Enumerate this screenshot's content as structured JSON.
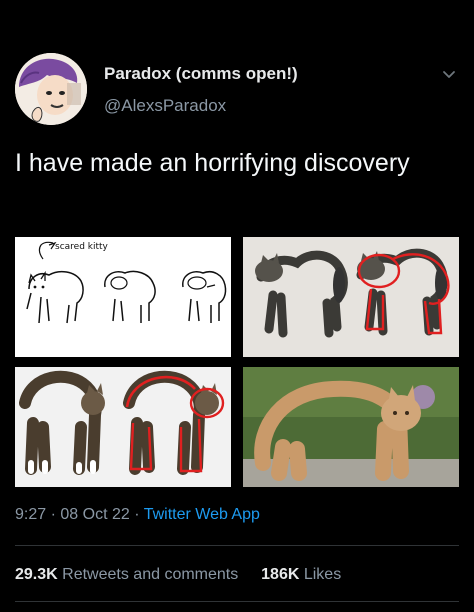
{
  "tweet": {
    "author": {
      "display_name": "Paradox (comms open!)",
      "handle": "@AlexsParadox"
    },
    "text": "I have made an horrifying discovery",
    "media": [
      {
        "caption": "scared kitty"
      },
      {},
      {},
      {}
    ],
    "meta": {
      "time": "9:27",
      "separator": "·",
      "date": "08 Oct 22",
      "app": "Twitter Web App"
    },
    "stats": {
      "retweets_count": "29.3K",
      "retweets_label": "Retweets and comments",
      "likes_count": "186K",
      "likes_label": "Likes"
    }
  },
  "colors": {
    "background": "#000000",
    "text": "#e7e9ea",
    "muted": "#8b98a5",
    "link": "#1d9bf0",
    "highlight": "#e02020"
  },
  "icons": {
    "more": "chevron-down-icon"
  }
}
